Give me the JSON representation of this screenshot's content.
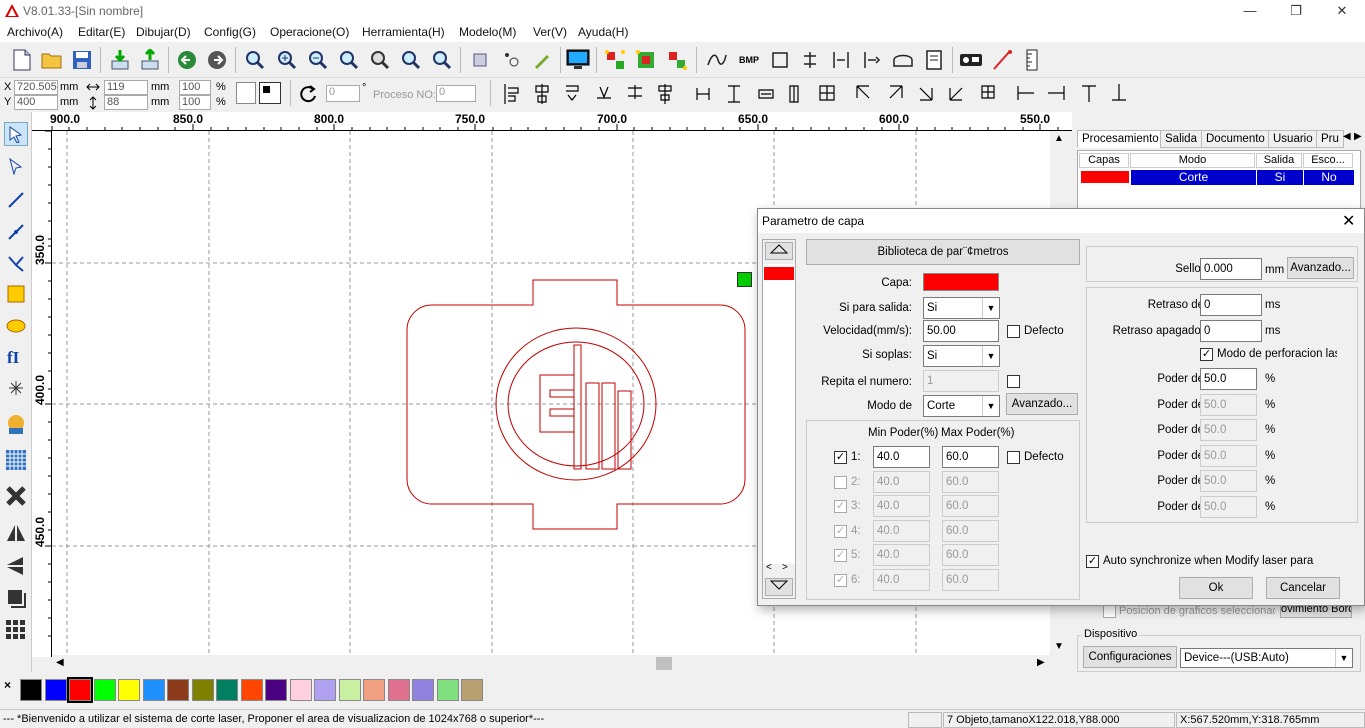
{
  "window": {
    "title": "V8.01.33-[Sin nombre]"
  },
  "menu": [
    "Archivo(A)",
    "Editar(E)",
    "Dibujar(D)",
    "Config(G)",
    "Operacione(O)",
    "Herramienta(H)",
    "Modelo(M)",
    "Ver(V)",
    "Ayuda(H)"
  ],
  "coords": {
    "x_label": "X",
    "y_label": "Y",
    "x_value": "720.505",
    "y_value": "400",
    "unit": "mm",
    "width": "119",
    "height": "88",
    "scale_w": "100",
    "scale_h": "100",
    "pct": "%",
    "rotation": "0",
    "degree": "°",
    "proceso_label": "Proceso NO:",
    "proceso_value": "0"
  },
  "ruler": {
    "h_labels": [
      "900.0",
      "850.0",
      "800.0",
      "750.0",
      "700.0",
      "650.0",
      "600.0",
      "550.0"
    ],
    "v_labels": [
      "350.0",
      "400.0",
      "450.0"
    ]
  },
  "right_panel": {
    "tabs": [
      "Procesamiento",
      "Salida",
      "Documento",
      "Usuario",
      "Pru"
    ],
    "table_headers": [
      "Capas",
      "Modo",
      "Salida",
      "Esco..."
    ],
    "row": {
      "mode": "Corte",
      "output": "Si",
      "esco": "No",
      "color": "#ff0000"
    },
    "pos_label": "Posicion de graficos seleccionado",
    "mov_btn": "ovimiento Bord",
    "dispositivo_label": "Dispositivo",
    "config_btn": "Configuraciones",
    "device_value": "Device---(USB:Auto)"
  },
  "dialog": {
    "title": "Parametro de capa",
    "library_btn": "Biblioteca de par¨¢metros",
    "capa_label": "Capa:",
    "capa_color": "#ff0000",
    "output_label": "Si para salida:",
    "output_value": "Si",
    "speed_label": "Velocidad(mm/s):",
    "speed_value": "50.00",
    "defecto": "Defecto",
    "blow_label": "Si soplas:",
    "blow_value": "Si",
    "repeat_label": "Repita el numero:",
    "repeat_value": "1",
    "mode_label": "Modo de",
    "mode_value": "Corte",
    "avanzado": "Avanzado...",
    "min_power_hdr": "Min Poder(%)",
    "max_power_hdr": "Max Poder(%)",
    "powers": [
      {
        "n": "1:",
        "min": "40.0",
        "max": "60.0",
        "checked": true,
        "enabled": true
      },
      {
        "n": "2:",
        "min": "40.0",
        "max": "60.0",
        "checked": false,
        "enabled": false
      },
      {
        "n": "3:",
        "min": "40.0",
        "max": "60.0",
        "checked": true,
        "enabled": false
      },
      {
        "n": "4:",
        "min": "40.0",
        "max": "60.0",
        "checked": true,
        "enabled": false
      },
      {
        "n": "5:",
        "min": "40.0",
        "max": "60.0",
        "checked": true,
        "enabled": false
      },
      {
        "n": "6:",
        "min": "40.0",
        "max": "60.0",
        "checked": true,
        "enabled": false
      }
    ],
    "seal_label": "Sello:",
    "seal_value": "0.000",
    "mm": "mm",
    "ms": "ms",
    "pct": "%",
    "delay_label": "Retraso de",
    "delay_value": "0",
    "delay_off_label": "Retraso apagado:",
    "delay_off_value": "0",
    "perf_mode": "Modo de perforacion lase",
    "poder_label": "Poder de",
    "poder_values": [
      "50.0",
      "50.0",
      "50.0",
      "50.0",
      "50.0",
      "50.0"
    ],
    "auto_sync": "Auto synchronize when Modify laser para",
    "ok": "Ok",
    "cancel": "Cancelar"
  },
  "palette": [
    "#000000",
    "#0000ff",
    "#ff0000",
    "#00ff00",
    "#ffff00",
    "#1e90ff",
    "#8b3a1a",
    "#808000",
    "#008060",
    "#ff4500",
    "#4b0082",
    "#ffd0e0",
    "#b0a0f0",
    "#c8f0a0",
    "#f0a080",
    "#e07090",
    "#9080e0",
    "#80e080",
    "#b8a070"
  ],
  "status": {
    "message": "--- *Bienvenido a utilizar el sistema de corte laser, Proponer el area de visualizacion de 1024x768 o superior*---",
    "objects": "7 Objeto,tamanoX122.018,Y88.000",
    "position": "X:567.520mm,Y:318.765mm"
  }
}
